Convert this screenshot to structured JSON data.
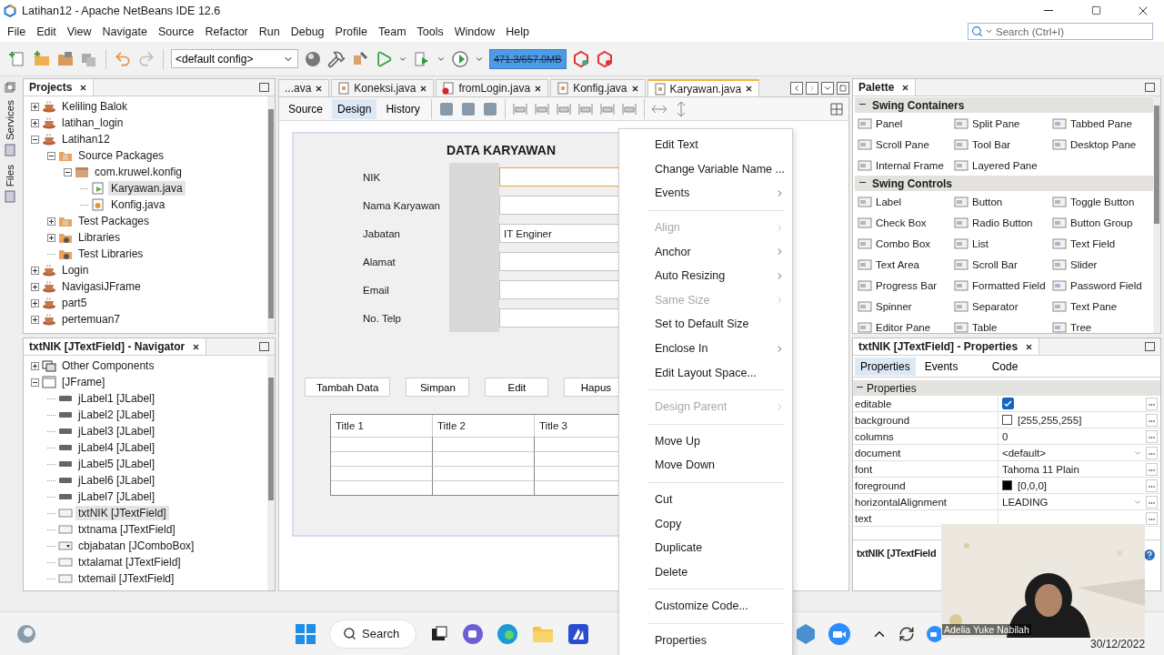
{
  "window": {
    "title": "Latihan12 - Apache NetBeans IDE 12.6"
  },
  "menu": [
    "File",
    "Edit",
    "View",
    "Navigate",
    "Source",
    "Refactor",
    "Run",
    "Debug",
    "Profile",
    "Team",
    "Tools",
    "Window",
    "Help"
  ],
  "search": {
    "placeholder": "Search (Ctrl+I)"
  },
  "toolbar": {
    "config": "<default config>",
    "memory": "471.3/657.0MB"
  },
  "side_strip": [
    "Services",
    "Files"
  ],
  "projects": {
    "title": "Projects",
    "tree": [
      {
        "label": "Keliling Balok",
        "kind": "project",
        "expanded": false,
        "selected": false
      },
      {
        "label": "latihan_login",
        "kind": "project",
        "expanded": false,
        "selected": false
      },
      {
        "label": "Latihan12",
        "kind": "project",
        "expanded": true,
        "selected": false,
        "children": [
          {
            "label": "Source Packages",
            "kind": "folder",
            "expanded": true,
            "selected": false,
            "children": [
              {
                "label": "com.kruwel.konfig",
                "kind": "package",
                "expanded": true,
                "selected": false,
                "children": [
                  {
                    "label": "Karyawan.java",
                    "kind": "form",
                    "selected": true
                  },
                  {
                    "label": "Konfig.java",
                    "kind": "class",
                    "selected": false
                  }
                ]
              }
            ]
          },
          {
            "label": "Test Packages",
            "kind": "folder",
            "expanded": false,
            "selected": false
          },
          {
            "label": "Libraries",
            "kind": "library",
            "expanded": false,
            "selected": false
          },
          {
            "label": "Test Libraries",
            "kind": "library",
            "selected": false
          }
        ]
      },
      {
        "label": "Login",
        "kind": "project",
        "expanded": false,
        "selected": false
      },
      {
        "label": "NavigasiJFrame",
        "kind": "project",
        "expanded": false,
        "selected": false
      },
      {
        "label": "part5",
        "kind": "project",
        "expanded": false,
        "selected": false
      },
      {
        "label": "pertemuan7",
        "kind": "project",
        "expanded": false,
        "selected": false
      }
    ]
  },
  "navigator": {
    "title": "txtNIK [JTextField] - Navigator",
    "tree": [
      {
        "label": "Other Components",
        "kind": "other",
        "expanded": false,
        "selected": false
      },
      {
        "label": "[JFrame]",
        "kind": "frame",
        "expanded": true,
        "selected": false,
        "children": [
          {
            "label": "jLabel1 [JLabel]",
            "kind": "label",
            "selected": false
          },
          {
            "label": "jLabel2 [JLabel]",
            "kind": "label",
            "selected": false
          },
          {
            "label": "jLabel3 [JLabel]",
            "kind": "label",
            "selected": false
          },
          {
            "label": "jLabel4 [JLabel]",
            "kind": "label",
            "selected": false
          },
          {
            "label": "jLabel5 [JLabel]",
            "kind": "label",
            "selected": false
          },
          {
            "label": "jLabel6 [JLabel]",
            "kind": "label",
            "selected": false
          },
          {
            "label": "jLabel7 [JLabel]",
            "kind": "label",
            "selected": false
          },
          {
            "label": "txtNIK [JTextField]",
            "kind": "textfield",
            "selected": true
          },
          {
            "label": "txtnama [JTextField]",
            "kind": "textfield",
            "selected": false
          },
          {
            "label": "cbjabatan [JComboBox]",
            "kind": "combobox",
            "selected": false
          },
          {
            "label": "txtalamat [JTextField]",
            "kind": "textfield",
            "selected": false
          },
          {
            "label": "txtemail [JTextField]",
            "kind": "textfield",
            "selected": false
          }
        ]
      }
    ]
  },
  "editor_tabs": [
    {
      "label": "...ava",
      "selected": false,
      "error": false
    },
    {
      "label": "Koneksi.java",
      "selected": false,
      "error": false
    },
    {
      "label": "fromLogin.java",
      "selected": false,
      "error": true
    },
    {
      "label": "Konfig.java",
      "selected": false,
      "error": false
    },
    {
      "label": "Karyawan.java",
      "selected": true,
      "error": false
    }
  ],
  "view_tabs": [
    {
      "label": "Source",
      "selected": false
    },
    {
      "label": "Design",
      "selected": true
    },
    {
      "label": "History",
      "selected": false
    }
  ],
  "form": {
    "title": "DATA KARYAWAN",
    "fields": [
      {
        "label": "NIK",
        "selected": true
      },
      {
        "label": "Nama Karyawan",
        "selected": false
      },
      {
        "label": "Jabatan",
        "value": "IT Enginer",
        "selected": false
      },
      {
        "label": "Alamat",
        "selected": false
      },
      {
        "label": "Email",
        "selected": false
      },
      {
        "label": "No. Telp",
        "selected": false
      }
    ],
    "buttons": [
      "Tambah Data",
      "Simpan",
      "Edit",
      "Hapus"
    ],
    "table": {
      "columns": [
        "Title 1",
        "Title 2",
        "Title 3"
      ]
    }
  },
  "context_menu": {
    "items": [
      {
        "kind": "item",
        "label": "Edit Text",
        "disabled": false,
        "submenu": false
      },
      {
        "kind": "item",
        "label": "Change Variable Name ...",
        "disabled": false,
        "submenu": false
      },
      {
        "kind": "item",
        "label": "Events",
        "disabled": false,
        "submenu": true
      },
      {
        "kind": "separator"
      },
      {
        "kind": "item",
        "label": "Align",
        "disabled": true,
        "submenu": true
      },
      {
        "kind": "item",
        "label": "Anchor",
        "disabled": false,
        "submenu": true
      },
      {
        "kind": "item",
        "label": "Auto Resizing",
        "disabled": false,
        "submenu": true
      },
      {
        "kind": "item",
        "label": "Same Size",
        "disabled": true,
        "submenu": true
      },
      {
        "kind": "item",
        "label": "Set to Default Size",
        "disabled": false,
        "submenu": false
      },
      {
        "kind": "item",
        "label": "Enclose In",
        "disabled": false,
        "submenu": true
      },
      {
        "kind": "item",
        "label": "Edit Layout Space...",
        "disabled": false,
        "submenu": false
      },
      {
        "kind": "separator"
      },
      {
        "kind": "item",
        "label": "Design Parent",
        "disabled": true,
        "submenu": true
      },
      {
        "kind": "separator"
      },
      {
        "kind": "item",
        "label": "Move Up",
        "disabled": false,
        "submenu": false
      },
      {
        "kind": "item",
        "label": "Move Down",
        "disabled": false,
        "submenu": false
      },
      {
        "kind": "separator"
      },
      {
        "kind": "item",
        "label": "Cut",
        "disabled": false,
        "submenu": false
      },
      {
        "kind": "item",
        "label": "Copy",
        "disabled": false,
        "submenu": false
      },
      {
        "kind": "item",
        "label": "Duplicate",
        "disabled": false,
        "submenu": false
      },
      {
        "kind": "item",
        "label": "Delete",
        "disabled": false,
        "submenu": false
      },
      {
        "kind": "separator"
      },
      {
        "kind": "item",
        "label": "Customize Code...",
        "disabled": false,
        "submenu": false
      },
      {
        "kind": "separator"
      },
      {
        "kind": "item",
        "label": "Properties",
        "disabled": false,
        "submenu": false
      }
    ]
  },
  "palette": {
    "title": "Palette",
    "sections": [
      {
        "title": "Swing Containers",
        "expanded": true,
        "items": [
          "Panel",
          "Split Pane",
          "Tabbed Pane",
          "Scroll Pane",
          "Tool Bar",
          "Desktop Pane",
          "Internal Frame",
          "Layered Pane"
        ]
      },
      {
        "title": "Swing Controls",
        "expanded": true,
        "items": [
          "Label",
          "Button",
          "Toggle Button",
          "Check Box",
          "Radio Button",
          "Button Group",
          "Combo Box",
          "List",
          "Text Field",
          "Text Area",
          "Scroll Bar",
          "Slider",
          "Progress Bar",
          "Formatted Field",
          "Password Field",
          "Spinner",
          "Separator",
          "Text Pane",
          "Editor Pane",
          "Table",
          "Tree"
        ]
      }
    ]
  },
  "properties": {
    "title": "txtNIK [JTextField] - Properties",
    "tabs": [
      {
        "label": "Properties",
        "selected": true
      },
      {
        "label": "Events",
        "selected": false
      },
      {
        "label": "Code",
        "selected": false
      }
    ],
    "section": "Properties",
    "rows": [
      {
        "name": "editable",
        "kind": "checkbox",
        "checked": true
      },
      {
        "name": "background",
        "kind": "color",
        "color": "#ffffff",
        "value": "[255,255,255]"
      },
      {
        "name": "columns",
        "kind": "text",
        "value": "0"
      },
      {
        "name": "document",
        "kind": "dropdown",
        "value": "<default>"
      },
      {
        "name": "font",
        "kind": "text",
        "value": "Tahoma 11 Plain"
      },
      {
        "name": "foreground",
        "kind": "color",
        "color": "#000000",
        "value": "[0,0,0]"
      },
      {
        "name": "horizontalAlignment",
        "kind": "dropdown",
        "value": "LEADING"
      },
      {
        "name": "text",
        "kind": "text"
      }
    ],
    "footer": "txtNIK [JTextField"
  },
  "taskbar": {
    "search": "Search",
    "date": "30/12/2022"
  },
  "webcam": {
    "kind": "picture",
    "name": "Adelia Yuke Nabilah"
  }
}
